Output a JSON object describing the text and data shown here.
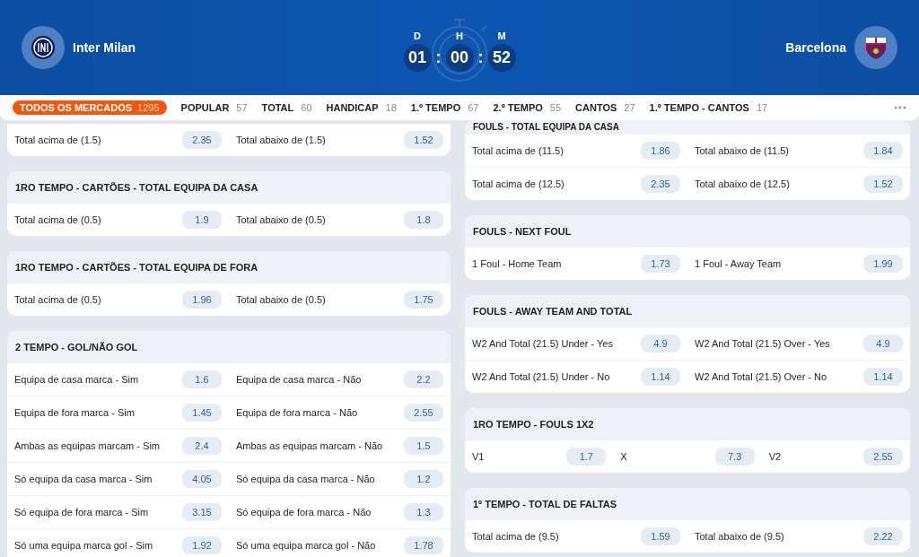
{
  "match": {
    "home": {
      "name": "Inter Milan"
    },
    "away": {
      "name": "Barcelona"
    },
    "countdown": [
      {
        "unit": "D",
        "value": "01"
      },
      {
        "unit": "H",
        "value": "00"
      },
      {
        "unit": "M",
        "value": "52"
      }
    ],
    "separator": ":"
  },
  "tabs": [
    {
      "label": "TODOS OS MERCADOS",
      "count": "1295",
      "selected": true
    },
    {
      "label": "POPULAR",
      "count": "57",
      "selected": false
    },
    {
      "label": "TOTAL",
      "count": "60",
      "selected": false
    },
    {
      "label": "HANDICAP",
      "count": "18",
      "selected": false
    },
    {
      "label": "1.º TEMPO",
      "count": "67",
      "selected": false
    },
    {
      "label": "2.º TEMPO",
      "count": "55",
      "selected": false
    },
    {
      "label": "CANTOS",
      "count": "27",
      "selected": false
    },
    {
      "label": "1.º TEMPO - CANTOS",
      "count": "17",
      "selected": false
    }
  ],
  "left_markets": [
    {
      "rows": [
        [
          {
            "label": "Total acima de (1.5)",
            "odds": "2.35"
          },
          {
            "label": "Total abaixo de (1.5)",
            "odds": "1.52"
          }
        ]
      ]
    },
    {
      "title": "1RO TEMPO - CARTÕES - TOTAL EQUIPA DA CASA",
      "rows": [
        [
          {
            "label": "Total acima de (0.5)",
            "odds": "1.9"
          },
          {
            "label": "Total abaixo de (0.5)",
            "odds": "1.8"
          }
        ]
      ]
    },
    {
      "title": "1RO TEMPO - CARTÕES - TOTAL EQUIPA DE FORA",
      "rows": [
        [
          {
            "label": "Total acima de (0.5)",
            "odds": "1.96"
          },
          {
            "label": "Total abaixo de (0.5)",
            "odds": "1.75"
          }
        ]
      ]
    },
    {
      "title": "2 TEMPO - GOL/NÃO GOL",
      "rows": [
        [
          {
            "label": "Equipa de casa marca - Sim",
            "odds": "1.6"
          },
          {
            "label": "Equipa de casa marca - Não",
            "odds": "2.2"
          }
        ],
        [
          {
            "label": "Equipa de fora marca - Sim",
            "odds": "1.45"
          },
          {
            "label": "Equipa de fora marca - Não",
            "odds": "2.55"
          }
        ],
        [
          {
            "label": "Ambas as equipas marcam - Sim",
            "odds": "2.4"
          },
          {
            "label": "Ambas as equipas marcam - Não",
            "odds": "1.5"
          }
        ],
        [
          {
            "label": "Só equipa da casa marca - Sim",
            "odds": "4.05"
          },
          {
            "label": "Só equipa da casa marca - Não",
            "odds": "1.2"
          }
        ],
        [
          {
            "label": "Só equipa de fora marca - Sim",
            "odds": "3.15"
          },
          {
            "label": "Só equipa de fora marca - Não",
            "odds": "1.3"
          }
        ],
        [
          {
            "label": "Só uma equipa marca gol - Sim",
            "odds": "1.92"
          },
          {
            "label": "Só uma equipa marca gol - Não",
            "odds": "1.78"
          }
        ]
      ]
    }
  ],
  "right_markets": [
    {
      "title": "FOULS - TOTAL EQUIPA DA CASA",
      "rows": [
        [
          {
            "label": "Total acima de (11.5)",
            "odds": "1.86"
          },
          {
            "label": "Total abaixo de (11.5)",
            "odds": "1.84"
          }
        ],
        [
          {
            "label": "Total acima de (12.5)",
            "odds": "2.35"
          },
          {
            "label": "Total abaixo de (12.5)",
            "odds": "1.52"
          }
        ]
      ]
    },
    {
      "title": "FOULS - NEXT FOUL",
      "rows": [
        [
          {
            "label": "1 Foul - Home Team",
            "odds": "1.73"
          },
          {
            "label": "1 Foul - Away Team",
            "odds": "1.99"
          }
        ]
      ]
    },
    {
      "title": "FOULS - AWAY TEAM AND TOTAL",
      "rows": [
        [
          {
            "label": "W2 And Total (21.5) Under - Yes",
            "odds": "4.9"
          },
          {
            "label": "W2 And Total (21.5) Over - Yes",
            "odds": "4.9"
          }
        ],
        [
          {
            "label": "W2 And Total (21.5) Under - No",
            "odds": "1.14"
          },
          {
            "label": "W2 And Total (21.5) Over - No",
            "odds": "1.14"
          }
        ]
      ]
    },
    {
      "title": "1RO TEMPO - FOULS 1X2",
      "rows": [
        [
          {
            "label": "V1",
            "odds": "1.7"
          },
          {
            "label": "X",
            "odds": "7.3"
          },
          {
            "label": "V2",
            "odds": "2.55"
          }
        ]
      ]
    },
    {
      "title": "1º TEMPO - TOTAL DE FALTAS",
      "rows": [
        [
          {
            "label": "Total acima de (9.5)",
            "odds": "1.59"
          },
          {
            "label": "Total abaixo de (9.5)",
            "odds": "2.22"
          }
        ]
      ]
    }
  ]
}
